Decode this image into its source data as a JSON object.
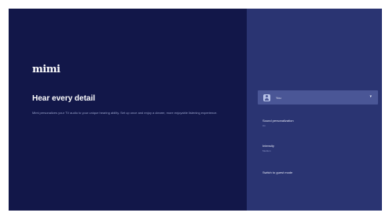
{
  "app": {
    "logo_text": "mimi"
  },
  "hero": {
    "title": "Hear every detail",
    "description": "Mimi personalizes your TV audio to your unique hearing ability. Set up once and enjoy a clearer, more enjoyable listening experience."
  },
  "profile": {
    "name": "You",
    "chevron": "▾"
  },
  "settings": [
    {
      "title": "Sound personalization",
      "value": "On"
    },
    {
      "title": "Intensity",
      "value": "Medium"
    }
  ],
  "guest_mode_label": "Switch to guest mode",
  "colors": {
    "left_panel": "#121749",
    "right_panel": "#2a3472",
    "profile_row": "#4a5696",
    "text_primary": "#ffffff",
    "text_secondary": "#9aa3cc"
  }
}
